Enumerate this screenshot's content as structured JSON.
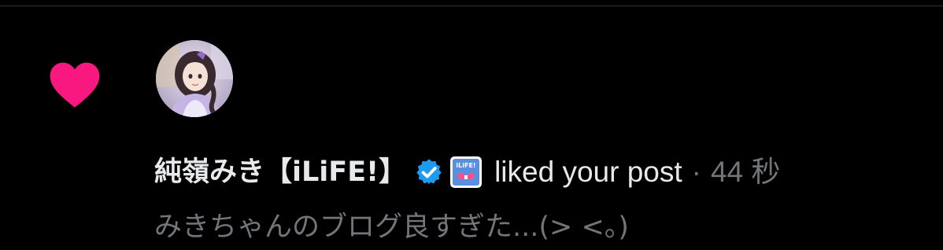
{
  "notification": {
    "type_icon": "heart-icon",
    "type_color": "#f91880",
    "actor": {
      "name": "純嶺みき【iLiFE!】",
      "verified_icon": "verified-badge-icon",
      "verified_color": "#1d9bf0",
      "affiliate_badge_icon": "ilife-affiliate-badge",
      "affiliate_badge_text": "iLiFE!"
    },
    "action": "liked your post",
    "separator": "·",
    "time": "44 秒",
    "post_preview": "みきちゃんのブログ良すぎた...(> <。)"
  }
}
